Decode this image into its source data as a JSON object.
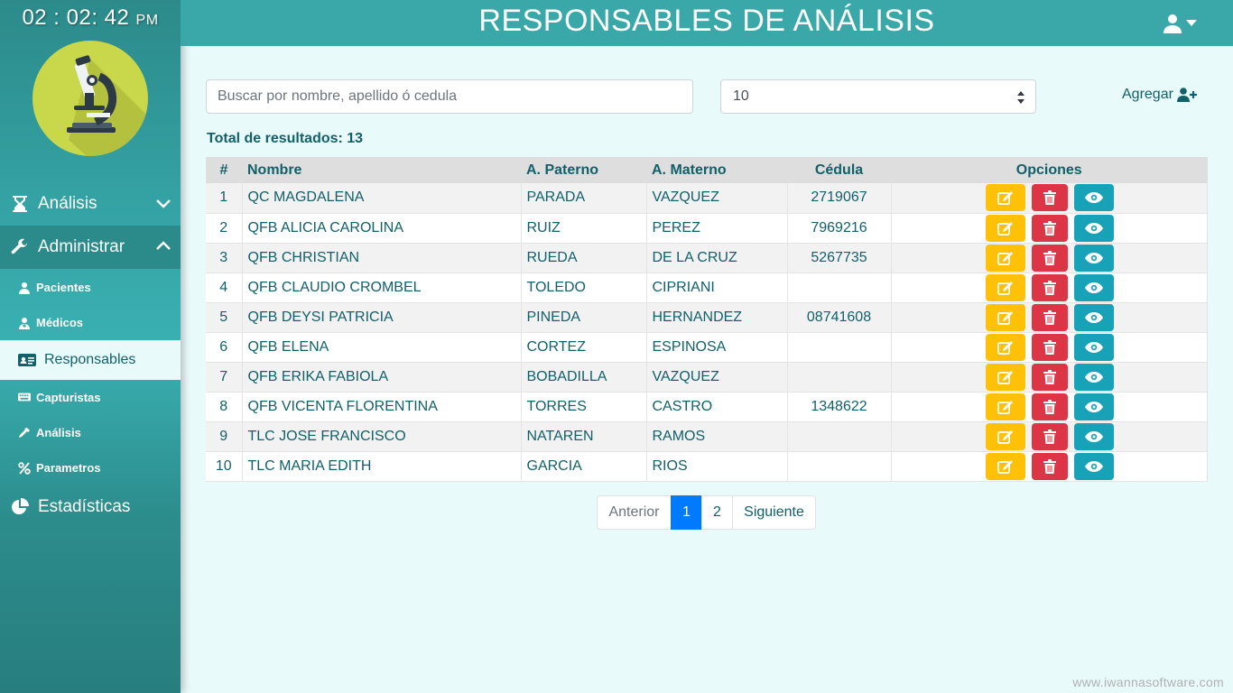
{
  "clock": {
    "time": "02 : 02: 42",
    "ampm": "PM"
  },
  "header": {
    "title": "RESPONSABLES DE ANÁLISIS"
  },
  "sidebar": {
    "analisis_label": "Análisis",
    "administrar_label": "Administrar",
    "sub_items": [
      {
        "label": "Pacientes",
        "icon": "user-injured-icon"
      },
      {
        "label": "Médicos",
        "icon": "user-md-icon"
      },
      {
        "label": "Responsables",
        "icon": "id-card-icon"
      },
      {
        "label": "Capturistas",
        "icon": "keyboard-icon"
      },
      {
        "label": "Análisis",
        "icon": "eyedropper-icon"
      },
      {
        "label": "Parametros",
        "icon": "percent-icon"
      }
    ],
    "estadisticas_label": "Estadísticas"
  },
  "search": {
    "placeholder": "Buscar por nombre, apellido ó cedula"
  },
  "page_size": {
    "value": "10"
  },
  "add_button": {
    "label": "Agregar"
  },
  "total": {
    "label": "Total de resultados: 13"
  },
  "table": {
    "headers": [
      "#",
      "Nombre",
      "A. Paterno",
      "A. Materno",
      "Cédula",
      "Opciones"
    ],
    "rows": [
      {
        "n": "1",
        "nombre": "QC MAGDALENA",
        "paterno": "PARADA",
        "materno": "VAZQUEZ",
        "cedula": "2719067"
      },
      {
        "n": "2",
        "nombre": "QFB ALICIA CAROLINA",
        "paterno": "RUIZ",
        "materno": "PEREZ",
        "cedula": "7969216"
      },
      {
        "n": "3",
        "nombre": "QFB CHRISTIAN",
        "paterno": "RUEDA",
        "materno": "DE LA CRUZ",
        "cedula": "5267735"
      },
      {
        "n": "4",
        "nombre": "QFB CLAUDIO CROMBEL",
        "paterno": "TOLEDO",
        "materno": "CIPRIANI",
        "cedula": ""
      },
      {
        "n": "5",
        "nombre": "QFB DEYSI PATRICIA",
        "paterno": "PINEDA",
        "materno": "HERNANDEZ",
        "cedula": "08741608"
      },
      {
        "n": "6",
        "nombre": "QFB ELENA",
        "paterno": "CORTEZ",
        "materno": "ESPINOSA",
        "cedula": ""
      },
      {
        "n": "7",
        "nombre": "QFB ERIKA FABIOLA",
        "paterno": "BOBADILLA",
        "materno": "VAZQUEZ",
        "cedula": ""
      },
      {
        "n": "8",
        "nombre": "QFB VICENTA FLORENTINA",
        "paterno": "TORRES",
        "materno": "CASTRO",
        "cedula": "1348622"
      },
      {
        "n": "9",
        "nombre": "TLC JOSE FRANCISCO",
        "paterno": "NATAREN",
        "materno": "RAMOS",
        "cedula": ""
      },
      {
        "n": "10",
        "nombre": "TLC MARIA EDITH",
        "paterno": "GARCIA",
        "materno": "RIOS",
        "cedula": ""
      }
    ]
  },
  "pagination": {
    "prev": "Anterior",
    "pages": [
      "1",
      "2"
    ],
    "current": "1",
    "next": "Siguiente"
  },
  "watermark": "www.iwannasoftware.com",
  "colors": {
    "header": "#3aa8a8",
    "edit": "#ffc107",
    "delete": "#dc3545",
    "view": "#17a2b8",
    "active_page": "#007bff",
    "text": "#12606a"
  }
}
